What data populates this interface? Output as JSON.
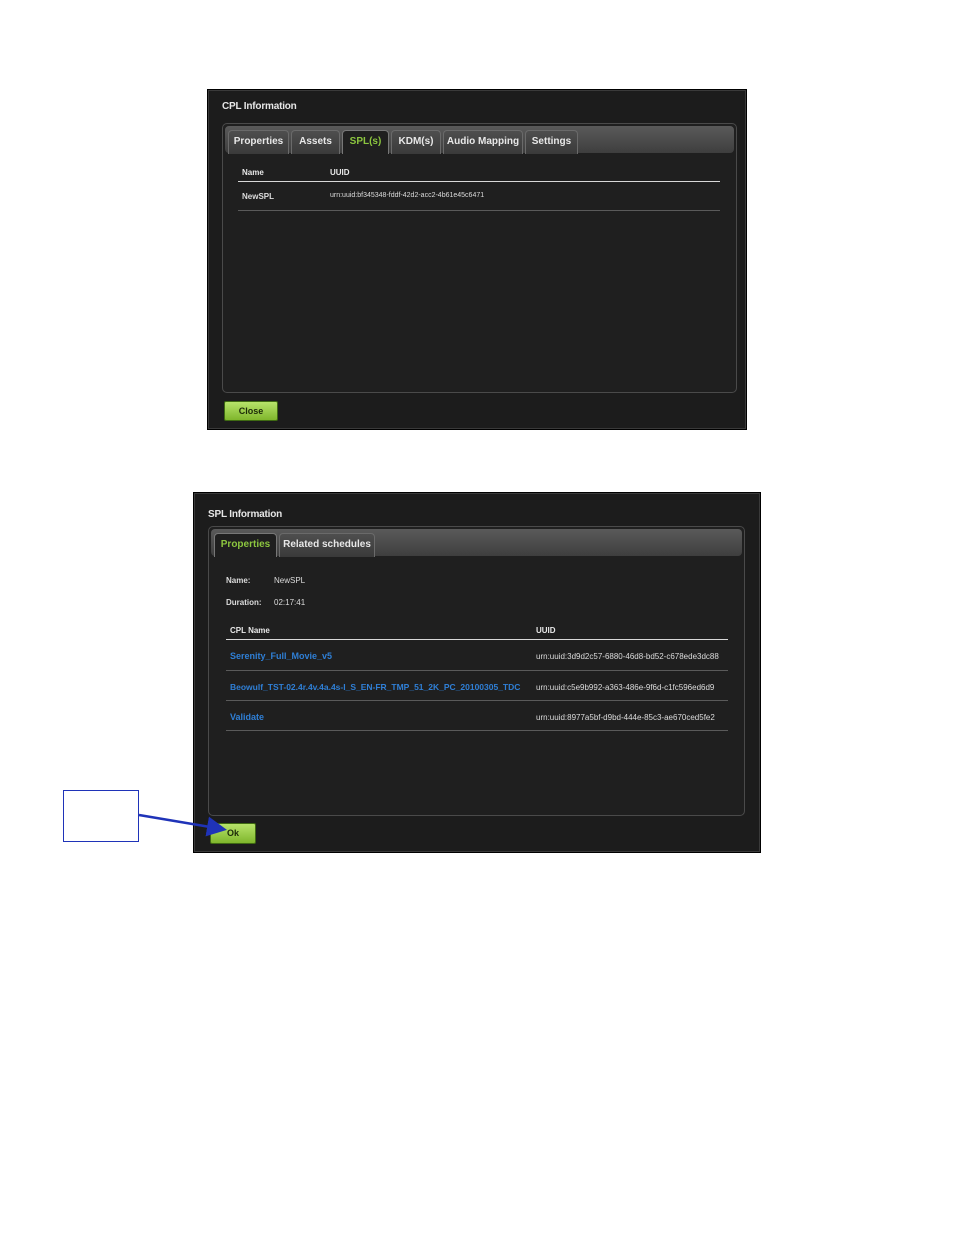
{
  "cpl_dialog": {
    "title": "CPL Information",
    "tabs": [
      "Properties",
      "Assets",
      "SPL(s)",
      "KDM(s)",
      "Audio Mapping",
      "Settings"
    ],
    "active_tab": "SPL(s)",
    "table": {
      "headers": [
        "Name",
        "UUID"
      ],
      "rows": [
        {
          "name": "NewSPL",
          "uuid": "urn:uuid:bf345348-fddf-42d2-acc2-4b61e45c6471"
        }
      ]
    },
    "close_label": "Close"
  },
  "spl_dialog": {
    "title": "SPL Information",
    "tabs": [
      "Properties",
      "Related schedules"
    ],
    "active_tab": "Properties",
    "name_label": "Name:",
    "name_value": "NewSPL",
    "duration_label": "Duration:",
    "duration_value": "02:17:41",
    "table": {
      "headers": [
        "CPL Name",
        "UUID"
      ],
      "rows": [
        {
          "name": "Serenity_Full_Movie_v5",
          "uuid": "urn:uuid:3d9d2c57-6880-46d8-bd52-c678ede3dc88"
        },
        {
          "name": "Beowulf_TST-02.4r.4v.4a.4s-I_S_EN-FR_TMP_51_2K_PC_20100305_TDC",
          "uuid": "urn:uuid:c5e9b992-a363-486e-9f6d-c1fc596ed6d9"
        },
        {
          "name": "Validate",
          "uuid": "urn:uuid:8977a5bf-d9bd-444e-85c3-ae670ced5fe2"
        }
      ]
    },
    "ok_label": "Ok"
  },
  "colors": {
    "accent_green": "#8cc63f",
    "link_blue": "#2f7fd6",
    "callout_blue": "#1f33b8"
  }
}
